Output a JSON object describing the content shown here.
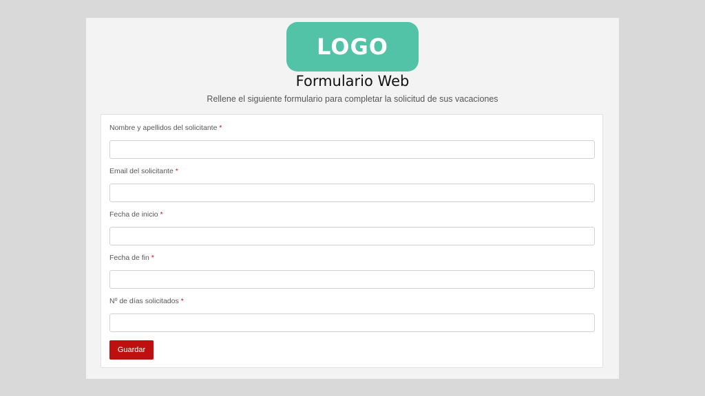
{
  "header": {
    "logo_text": "LOGO",
    "title": "Formulario Web",
    "subtitle": "Rellene el siguiente formulario para completar la solicitud de sus vacaciones"
  },
  "form": {
    "required_marker": "*",
    "fields": [
      {
        "label": "Nombre y apellidos del solicitante",
        "value": ""
      },
      {
        "label": "Email del solicitante",
        "value": ""
      },
      {
        "label": "Fecha de inicio",
        "value": ""
      },
      {
        "label": "Fecha de fin",
        "value": ""
      },
      {
        "label": "Nº de días solicitados",
        "value": ""
      }
    ],
    "submit_label": "Guardar"
  },
  "colors": {
    "logo_bg": "#52c3a6",
    "button_bg": "#bf1010",
    "required": "#c81414",
    "page_bg": "#d9d9d9"
  }
}
